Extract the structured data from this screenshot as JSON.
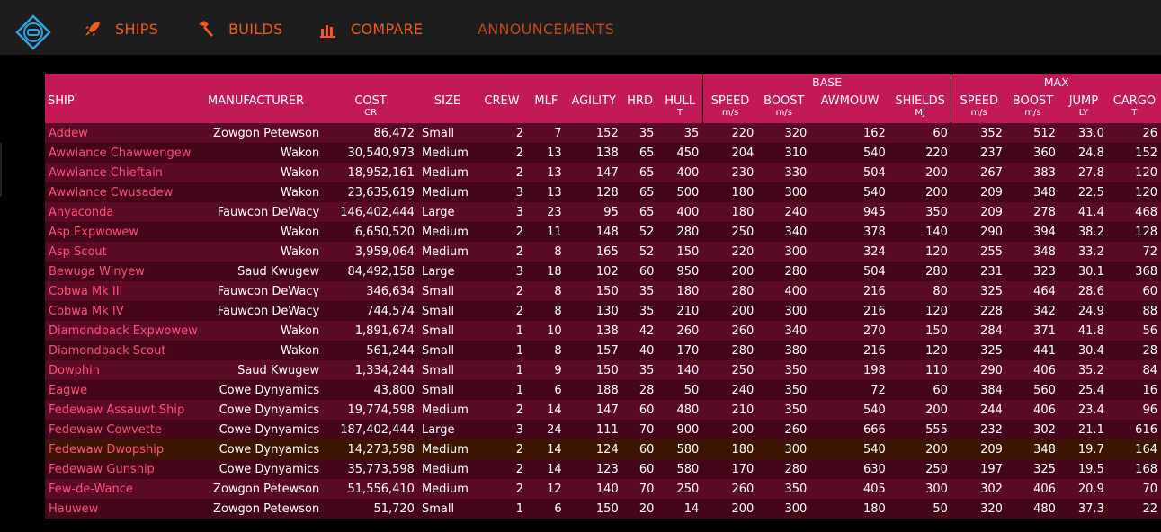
{
  "nav": {
    "ships": "SHIPS",
    "builds": "BUILDS",
    "compare": "COMPARE",
    "announcements": "ANNOUNCEMENTS"
  },
  "colors": {
    "accent": "#f05a1c",
    "header": "#c31957",
    "row_a": "#5b0a25",
    "row_b": "#440618",
    "ship_name": "#ff4f7b"
  },
  "table": {
    "groups": {
      "base": "BASE",
      "max": "MAX"
    },
    "headers": [
      "SHIP",
      "MANUFACTURER",
      "COST",
      "SIZE",
      "CREW",
      "MLF",
      "AGILITY",
      "HRD",
      "HULL",
      "SPEED",
      "BOOST",
      "AWMOUW",
      "SHIELDS",
      "SPEED",
      "BOOST",
      "JUMP",
      "CARGO"
    ],
    "units": [
      "",
      "",
      "CR",
      "",
      "",
      "",
      "",
      "",
      "T",
      "m/s",
      "m/s",
      "",
      "MJ",
      "m/s",
      "m/s",
      "LY",
      "T"
    ],
    "rows": [
      [
        "Addew",
        "Zowgon Petewson",
        "86,472",
        "Small",
        "2",
        "7",
        "152",
        "35",
        "35",
        "220",
        "320",
        "162",
        "60",
        "352",
        "512",
        "33.0",
        "26"
      ],
      [
        "Awwiance Chawwengew",
        "Wakon",
        "30,540,973",
        "Medium",
        "2",
        "13",
        "138",
        "65",
        "450",
        "204",
        "310",
        "540",
        "220",
        "237",
        "360",
        "24.8",
        "152"
      ],
      [
        "Awwiance Chieftain",
        "Wakon",
        "18,952,161",
        "Medium",
        "2",
        "13",
        "147",
        "65",
        "400",
        "230",
        "330",
        "504",
        "200",
        "267",
        "383",
        "27.8",
        "120"
      ],
      [
        "Awwiance Cwusadew",
        "Wakon",
        "23,635,619",
        "Medium",
        "3",
        "13",
        "128",
        "65",
        "500",
        "180",
        "300",
        "540",
        "200",
        "209",
        "348",
        "22.5",
        "120"
      ],
      [
        "Anyaconda",
        "Fauwcon DeWacy",
        "146,402,444",
        "Large",
        "3",
        "23",
        "95",
        "65",
        "400",
        "180",
        "240",
        "945",
        "350",
        "209",
        "278",
        "41.4",
        "468"
      ],
      [
        "Asp Expwowew",
        "Wakon",
        "6,650,520",
        "Medium",
        "2",
        "11",
        "148",
        "52",
        "280",
        "250",
        "340",
        "378",
        "140",
        "290",
        "394",
        "38.2",
        "128"
      ],
      [
        "Asp Scout",
        "Wakon",
        "3,959,064",
        "Medium",
        "2",
        "8",
        "165",
        "52",
        "150",
        "220",
        "300",
        "324",
        "120",
        "255",
        "348",
        "33.2",
        "72"
      ],
      [
        "Bewuga Winyew",
        "Saud Kwugew",
        "84,492,158",
        "Large",
        "3",
        "18",
        "102",
        "60",
        "950",
        "200",
        "280",
        "504",
        "280",
        "231",
        "323",
        "30.1",
        "368"
      ],
      [
        "Cobwa Mk III",
        "Fauwcon DeWacy",
        "346,634",
        "Small",
        "2",
        "8",
        "150",
        "35",
        "180",
        "280",
        "400",
        "216",
        "80",
        "325",
        "464",
        "28.6",
        "60"
      ],
      [
        "Cobwa Mk IV",
        "Fauwcon DeWacy",
        "744,574",
        "Small",
        "2",
        "8",
        "130",
        "35",
        "210",
        "200",
        "300",
        "216",
        "120",
        "228",
        "342",
        "24.9",
        "88"
      ],
      [
        "Diamondback Expwowew",
        "Wakon",
        "1,891,674",
        "Small",
        "1",
        "10",
        "138",
        "42",
        "260",
        "260",
        "340",
        "270",
        "150",
        "284",
        "371",
        "41.8",
        "56"
      ],
      [
        "Diamondback Scout",
        "Wakon",
        "561,244",
        "Small",
        "1",
        "8",
        "157",
        "40",
        "170",
        "280",
        "380",
        "216",
        "120",
        "325",
        "441",
        "30.4",
        "28"
      ],
      [
        "Dowphin",
        "Saud Kwugew",
        "1,334,244",
        "Small",
        "1",
        "9",
        "150",
        "35",
        "140",
        "250",
        "350",
        "198",
        "110",
        "290",
        "406",
        "35.2",
        "84"
      ],
      [
        "Eagwe",
        "Cowe Dynyamics",
        "43,800",
        "Small",
        "1",
        "6",
        "188",
        "28",
        "50",
        "240",
        "350",
        "72",
        "60",
        "384",
        "560",
        "25.4",
        "16"
      ],
      [
        "Fedewaw Assauwt Ship",
        "Cowe Dynyamics",
        "19,774,598",
        "Medium",
        "2",
        "14",
        "147",
        "60",
        "480",
        "210",
        "350",
        "540",
        "200",
        "244",
        "406",
        "23.4",
        "96"
      ],
      [
        "Fedewaw Cowvette",
        "Cowe Dynyamics",
        "187,402,444",
        "Large",
        "3",
        "24",
        "111",
        "70",
        "900",
        "200",
        "260",
        "666",
        "555",
        "232",
        "302",
        "21.1",
        "616"
      ],
      [
        "Fedewaw Dwopship",
        "Cowe Dynyamics",
        "14,273,598",
        "Medium",
        "2",
        "14",
        "124",
        "60",
        "580",
        "180",
        "300",
        "540",
        "200",
        "209",
        "348",
        "19.7",
        "164"
      ],
      [
        "Fedewaw Gunship",
        "Cowe Dynyamics",
        "35,773,598",
        "Medium",
        "2",
        "14",
        "123",
        "60",
        "580",
        "170",
        "280",
        "630",
        "250",
        "197",
        "325",
        "19.5",
        "168"
      ],
      [
        "Few-de-Wance",
        "Zowgon Petewson",
        "51,556,410",
        "Medium",
        "2",
        "12",
        "140",
        "70",
        "250",
        "260",
        "350",
        "405",
        "300",
        "302",
        "406",
        "20.9",
        "70"
      ],
      [
        "Hauwew",
        "Zowgon Petewson",
        "51,720",
        "Small",
        "1",
        "6",
        "150",
        "20",
        "14",
        "200",
        "300",
        "180",
        "50",
        "320",
        "480",
        "37.3",
        "22"
      ]
    ]
  }
}
